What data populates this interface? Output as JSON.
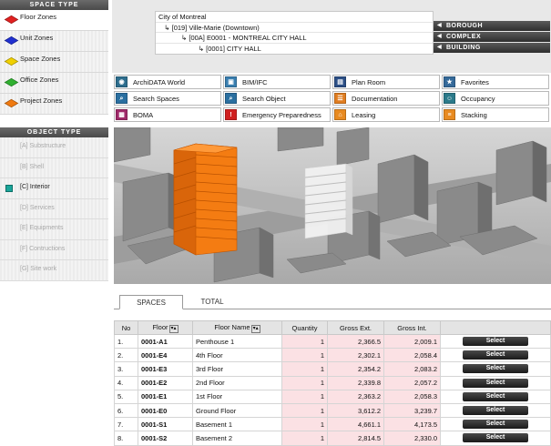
{
  "sidebar": {
    "space_type_header": "SPACE TYPE",
    "zones": [
      {
        "label": "Floor Zones",
        "color": "#e02020"
      },
      {
        "label": "Unit Zones",
        "color": "#2030d0"
      },
      {
        "label": "Space Zones",
        "color": "#f0d000"
      },
      {
        "label": "Office Zones",
        "color": "#30b030"
      },
      {
        "label": "Project Zones",
        "color": "#f07a10"
      }
    ],
    "object_type_header": "OBJECT TYPE",
    "objects": [
      {
        "label": "[A] Substructure"
      },
      {
        "label": "[B] Shell"
      },
      {
        "label": "[C] Interior"
      },
      {
        "label": "[D] Services"
      },
      {
        "label": "[E] Equipments"
      },
      {
        "label": "[F] Contructions"
      },
      {
        "label": "[G] Site work"
      }
    ]
  },
  "breadcrumb": {
    "lines": [
      "City of Montreal",
      "   ↳ [019] Ville-Marie (Downtown)",
      "            ↳ [00A] E0001 - MONTREAL CITY HALL",
      "                     ↳ [0001] CITY HALL"
    ],
    "buttons": [
      "BOROUGH",
      "COMPLEX",
      "BUILDING"
    ]
  },
  "modules": [
    {
      "label": "ArchiDATA World",
      "icon": "globe-icon",
      "color": "#2e6e8e",
      "glyph": "◉"
    },
    {
      "label": "BIM/IFC",
      "icon": "bim-icon",
      "color": "#3a7fb0",
      "glyph": "▣"
    },
    {
      "label": "Plan Room",
      "icon": "plan-icon",
      "color": "#2c4f86",
      "glyph": "▤"
    },
    {
      "label": "Favorites",
      "icon": "favorites-icon",
      "color": "#356a9a",
      "glyph": "★"
    },
    {
      "label": "Search Spaces",
      "icon": "search-icon",
      "color": "#2a6fa0",
      "glyph": "⌕"
    },
    {
      "label": "Search Object",
      "icon": "search-icon",
      "color": "#2a6fa0",
      "glyph": "⌕"
    },
    {
      "label": "Documentation",
      "icon": "document-icon",
      "color": "#e07d20",
      "glyph": "☰"
    },
    {
      "label": "Occupancy",
      "icon": "occupancy-icon",
      "color": "#2b7a8a",
      "glyph": "☺"
    },
    {
      "label": "BOMA",
      "icon": "grid-icon",
      "color": "#a02a6a",
      "glyph": "▦"
    },
    {
      "label": "Emergency Preparedness",
      "icon": "warning-icon",
      "color": "#d02020",
      "glyph": "!"
    },
    {
      "label": "Leasing",
      "icon": "leasing-icon",
      "color": "#e88a20",
      "glyph": "⌂"
    },
    {
      "label": "Stacking",
      "icon": "stacking-icon",
      "color": "#e88a20",
      "glyph": "≡"
    }
  ],
  "tabs": [
    "SPACES",
    "TOTAL"
  ],
  "table": {
    "headers": [
      "No",
      "Floor",
      "Floor Name",
      "Quantity",
      "Gross Ext.",
      "Gross Int.",
      ""
    ],
    "select_label": "Select",
    "rows": [
      {
        "no": "1.",
        "floor": "0001-A1",
        "name": "Penthouse 1",
        "qty": "1",
        "ext": "2,366.5",
        "int": "2,009.1"
      },
      {
        "no": "2.",
        "floor": "0001-E4",
        "name": "4th Floor",
        "qty": "1",
        "ext": "2,302.1",
        "int": "2,058.4"
      },
      {
        "no": "3.",
        "floor": "0001-E3",
        "name": "3rd Floor",
        "qty": "1",
        "ext": "2,354.2",
        "int": "2,083.2"
      },
      {
        "no": "4.",
        "floor": "0001-E2",
        "name": "2nd Floor",
        "qty": "1",
        "ext": "2,339.8",
        "int": "2,057.2"
      },
      {
        "no": "5.",
        "floor": "0001-E1",
        "name": "1st Floor",
        "qty": "1",
        "ext": "2,363.2",
        "int": "2,058.3"
      },
      {
        "no": "6.",
        "floor": "0001-E0",
        "name": "Ground Floor",
        "qty": "1",
        "ext": "3,612.2",
        "int": "3,239.7"
      },
      {
        "no": "7.",
        "floor": "0001-S1",
        "name": "Basement 1",
        "qty": "1",
        "ext": "4,661.1",
        "int": "4,173.5"
      },
      {
        "no": "8.",
        "floor": "0001-S2",
        "name": "Basement 2",
        "qty": "1",
        "ext": "2,814.5",
        "int": "2,330.0"
      }
    ]
  }
}
